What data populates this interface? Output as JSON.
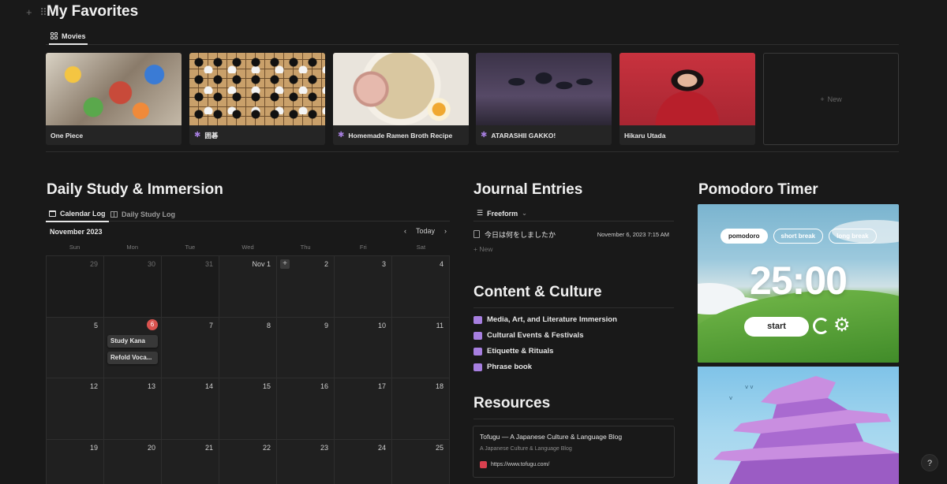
{
  "page": {
    "title": "My Favorites"
  },
  "gallery": {
    "tab_label": "Movies",
    "new_label": "New",
    "cards": [
      {
        "title": "One Piece",
        "sparkle": false,
        "thumb": "anime-collage"
      },
      {
        "title": "囲碁",
        "sparkle": true,
        "thumb": "go-board"
      },
      {
        "title": "Homemade Ramen Broth Recipe",
        "sparkle": true,
        "thumb": "ramen-bowl"
      },
      {
        "title": "ATARASHII GAKKO!",
        "sparkle": true,
        "thumb": "group-photo"
      },
      {
        "title": "Hikaru Utada",
        "sparkle": false,
        "thumb": "portrait-red"
      }
    ]
  },
  "study": {
    "heading": "Daily Study & Immersion",
    "tabs": [
      "Calendar Log",
      "Daily Study Log"
    ],
    "month": "November 2023",
    "today_label": "Today",
    "weekdays": [
      "Sun",
      "Mon",
      "Tue",
      "Wed",
      "Thu",
      "Fri",
      "Sat"
    ],
    "weeks": [
      [
        "29",
        "30",
        "31",
        "Nov 1",
        "2",
        "3",
        "4"
      ],
      [
        "5",
        "6",
        "7",
        "8",
        "9",
        "10",
        "11"
      ],
      [
        "12",
        "13",
        "14",
        "15",
        "16",
        "17",
        "18"
      ],
      [
        "19",
        "20",
        "21",
        "22",
        "23",
        "24",
        "25"
      ]
    ],
    "events": [
      "Study Kana",
      "Refold Voca..."
    ]
  },
  "journal": {
    "heading": "Journal Entries",
    "view_label": "Freeform",
    "entry_title": "今日は何をしましたか",
    "entry_date": "November 6, 2023 7:15 AM",
    "new_label": "New"
  },
  "culture": {
    "heading": "Content & Culture",
    "items": [
      "Media, Art, and Literature Immersion",
      "Cultural Events & Festivals",
      "Etiquette & Rituals",
      "Phrase book"
    ]
  },
  "resources": {
    "heading": "Resources",
    "bookmark_title": "Tofugu — A Japanese Culture & Language Blog",
    "bookmark_desc": "A Japanese Culture & Language Blog",
    "bookmark_url": "https://www.tofugu.com/"
  },
  "pomodoro": {
    "heading": "Pomodoro Timer",
    "modes": [
      "pomodoro",
      "short break",
      "long break"
    ],
    "time": "25:00",
    "start_label": "start"
  },
  "help_label": "?",
  "colors": {
    "background": "#191919",
    "accent_purple": "#a77fe0",
    "today_red": "#d9534f"
  }
}
